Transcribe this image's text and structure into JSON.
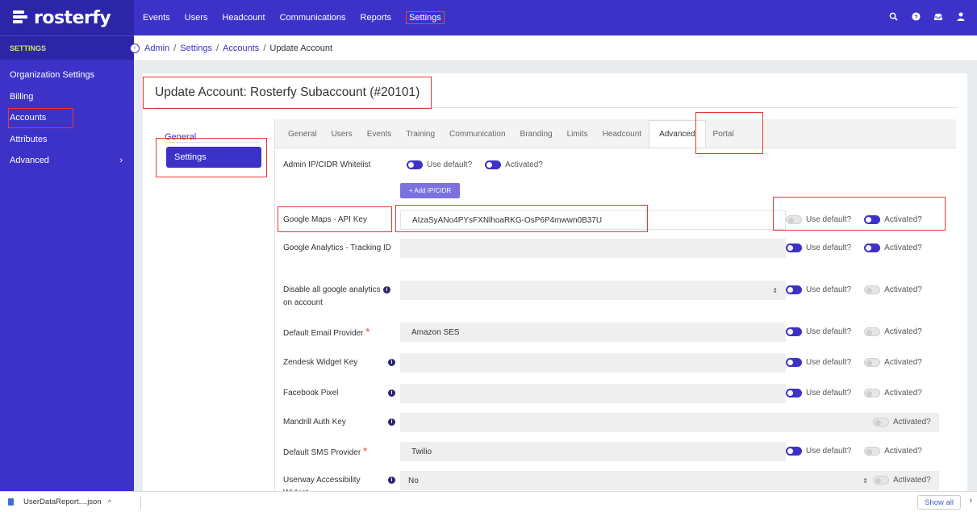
{
  "brand": {
    "name": "rosterfy"
  },
  "topnav": {
    "items": [
      "Events",
      "Users",
      "Headcount",
      "Communications",
      "Reports",
      "Settings"
    ],
    "active": "Settings",
    "icons": [
      "search-icon",
      "help-icon",
      "inbox-icon",
      "user-icon"
    ]
  },
  "sidebar": {
    "heading": "SETTINGS",
    "items": [
      {
        "label": "Organization Settings"
      },
      {
        "label": "Billing"
      },
      {
        "label": "Accounts"
      },
      {
        "label": "Attributes"
      },
      {
        "label": "Advanced",
        "chevron": "›"
      }
    ]
  },
  "breadcrumb": {
    "items": [
      "Admin",
      "Settings",
      "Accounts"
    ],
    "separator": "/",
    "current": "Update Account"
  },
  "page": {
    "title": "Update Account: Rosterfy Subaccount (#20101)"
  },
  "subnav": {
    "general": "General",
    "settings": "Settings"
  },
  "tabs": [
    "General",
    "Users",
    "Events",
    "Training",
    "Communication",
    "Branding",
    "Limits",
    "Headcount",
    "Advanced",
    "Portal"
  ],
  "active_tab": "Advanced",
  "labels": {
    "use_default": "Use default?",
    "activated": "Activated?",
    "add_ip": "+ Add IP/CIDR"
  },
  "rows": [
    {
      "label": "Admin IP/CIDR Whitelist",
      "use_default": true,
      "activated": true
    },
    {
      "label": "Google Maps - API Key",
      "value": "AIzaSyANo4PYsFXNlhoaRKG-OsP6P4mwwn0B37U",
      "use_default": false,
      "activated": true
    },
    {
      "label": "Google Analytics - Tracking ID",
      "value": "",
      "use_default": true,
      "activated": true
    },
    {
      "label": "Disable all google analytics on account",
      "value": "",
      "use_default": true,
      "activated": false
    },
    {
      "label": "Default Email Provider",
      "required": "*",
      "value": "Amazon SES",
      "use_default": true,
      "activated": false
    },
    {
      "label": "Zendesk Widget Key",
      "value": "",
      "use_default": true,
      "activated": false
    },
    {
      "label": "Facebook Pixel",
      "value": "",
      "use_default": true,
      "activated": false
    },
    {
      "label": "Mandrill Auth Key",
      "value": "",
      "activated": false
    },
    {
      "label": "Default SMS Provider",
      "required": "*",
      "value": "Twilio",
      "use_default": true,
      "activated": false
    },
    {
      "label": "Userway Accessibility Widget",
      "value": "No",
      "activated": false
    }
  ],
  "download": {
    "filename": "UserDataReport....json",
    "show_all": "Show all"
  },
  "colors": {
    "brand": "#3c32c8",
    "brand_dark": "#2d25a8",
    "highlight": "#e53935"
  }
}
